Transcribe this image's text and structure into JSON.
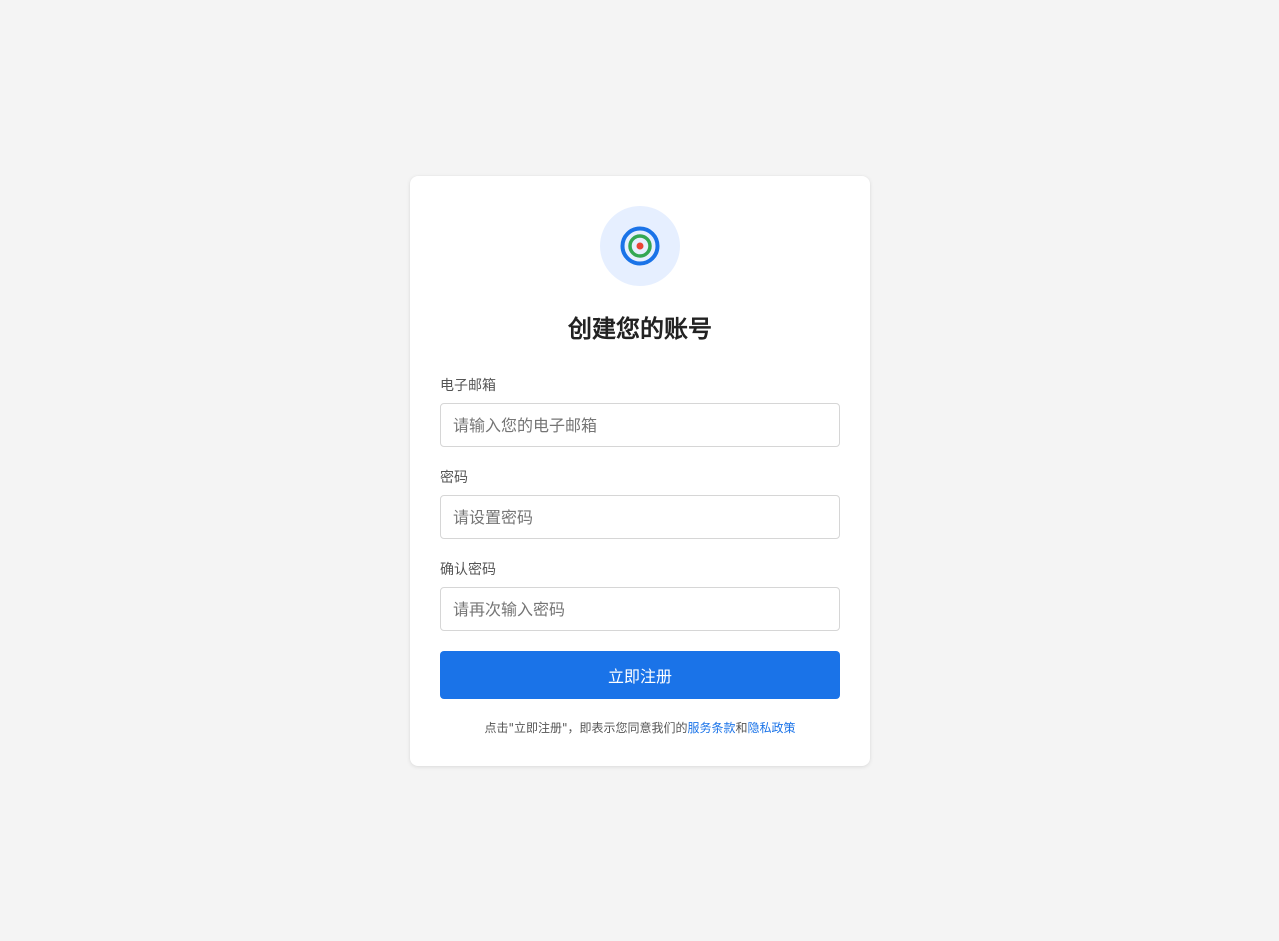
{
  "colors": {
    "background": "#f4f4f4",
    "card": "#ffffff",
    "primary": "#1a73e8",
    "logo_bg": "#e6efff",
    "logo_ring_outer": "#1a73e8",
    "logo_ring_inner": "#34a853",
    "logo_dot": "#ea4335"
  },
  "logo": {
    "icon": "target-icon"
  },
  "title": "创建您的账号",
  "fields": {
    "email": {
      "label": "电子邮箱",
      "placeholder": "请输入您的电子邮箱",
      "value": ""
    },
    "password": {
      "label": "密码",
      "placeholder": "请设置密码",
      "value": ""
    },
    "confirm_password": {
      "label": "确认密码",
      "placeholder": "请再次输入密码",
      "value": ""
    }
  },
  "submit_label": "立即注册",
  "terms": {
    "prefix": "点击\"立即注册\"，即表示您同意我们的",
    "terms_link": "服务条款",
    "joiner": "和",
    "privacy_link": "隐私政策"
  }
}
